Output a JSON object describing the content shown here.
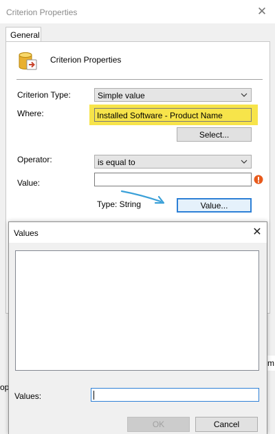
{
  "criterion_dialog": {
    "title": "Criterion Properties",
    "close_glyph": "✕",
    "tab_general": "General",
    "header_title": "Criterion Properties",
    "criterion_type_label": "Criterion Type:",
    "criterion_type_value": "Simple value",
    "where_label": "Where:",
    "where_value": "Installed Software - Product Name",
    "select_button": "Select...",
    "operator_label": "Operator:",
    "operator_value": "is equal to",
    "value_label": "Value:",
    "value_input": "",
    "type_label": "Type: String",
    "value_button": "Value...",
    "partial_right_letter": "m",
    "partial_left_text": "op"
  },
  "values_dialog": {
    "title": "Values",
    "close_glyph": "✕",
    "values_label": "Values:",
    "values_input": "",
    "ok_button": "OK",
    "cancel_button": "Cancel"
  },
  "colors": {
    "highlight": "#f7e44a",
    "accent": "#2c7fd6",
    "error": "#e85a1c",
    "annotation_arrow": "#3aa0d8"
  },
  "icons": {
    "header": "database-criterion-icon",
    "dropdown": "chevron-down-icon",
    "error": "error-icon"
  }
}
